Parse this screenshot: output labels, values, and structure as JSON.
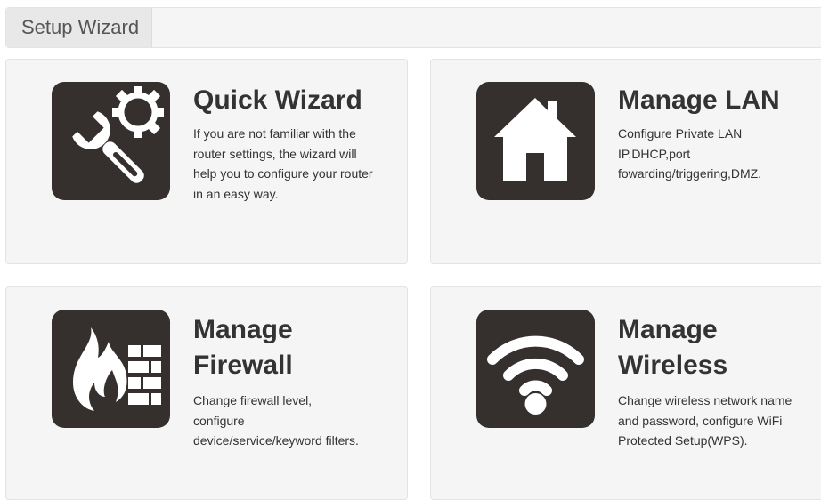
{
  "header": {
    "tab_label": "Setup Wizard"
  },
  "cards": [
    {
      "title": "Quick Wizard",
      "description": "If you are not familiar with the router settings, the wizard will help you to configure your router in an easy way.",
      "icon": "wrench-gear-icon"
    },
    {
      "title": "Manage LAN",
      "description": "Configure Private LAN IP,DHCP,port fowarding/triggering,DMZ.",
      "icon": "house-icon"
    },
    {
      "title": "Manage Firewall",
      "description": "Change firewall level, configure device/service/keyword filters.",
      "icon": "firewall-icon"
    },
    {
      "title": "Manage Wireless",
      "description": "Change wireless network name and password, configure WiFi Protected Setup(WPS).",
      "icon": "wifi-icon"
    }
  ],
  "colors": {
    "icon_background": "#352f2d",
    "card_background": "#f5f5f5",
    "title_text": "#333333"
  }
}
